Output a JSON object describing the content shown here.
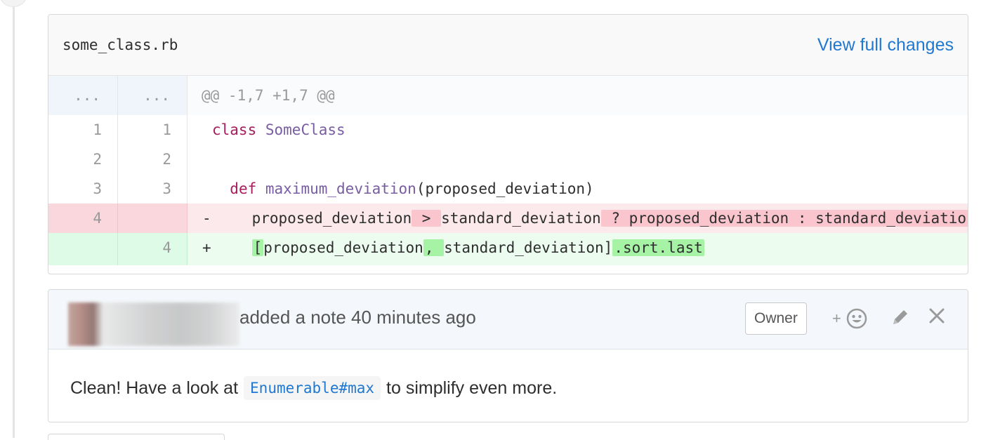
{
  "file": {
    "name": "some_class.rb",
    "view_full_changes": "View full changes"
  },
  "diff": {
    "hunk": {
      "old_num": "...",
      "new_num": "...",
      "text": "@@ -1,7 +1,7 @@"
    },
    "lines": [
      {
        "old": "1",
        "new": "1",
        "type": "context"
      },
      {
        "old": "2",
        "new": "2",
        "type": "context"
      },
      {
        "old": "3",
        "new": "3",
        "type": "context"
      },
      {
        "old": "4",
        "new": "",
        "type": "removed",
        "sign": "-"
      },
      {
        "old": "",
        "new": "4",
        "type": "added",
        "sign": "+"
      }
    ],
    "code": {
      "line1_kw": "class",
      "line1_cls": "SomeClass",
      "line3_kw": "def",
      "line3_fn": "maximum_deviation",
      "line3_rest": "(proposed_deviation)",
      "line4_a": "proposed_deviation",
      "line4_hl1": " > ",
      "line4_b": "standard_deviation",
      "line4_hl2": " ? proposed_deviation : standard_deviation",
      "line5_hl1": "[",
      "line5_a": "proposed_deviation",
      "line5_hl2": ", ",
      "line5_b": "standard_deviation]",
      "line5_hl3": ".sort.last"
    }
  },
  "note": {
    "meta": "added a note 40 minutes ago",
    "badge": "Owner",
    "icons": [
      "add-reaction-icon",
      "pencil-icon",
      "close-icon"
    ],
    "add_reaction_plus": "+",
    "body_before": "Clean! Have a look at",
    "body_code": "Enumerable#max",
    "body_after": "to simplify even more."
  },
  "colors": {
    "link": "#1f78d1",
    "removed_bg": "#fbe9eb",
    "added_bg": "#ecfdf0"
  }
}
